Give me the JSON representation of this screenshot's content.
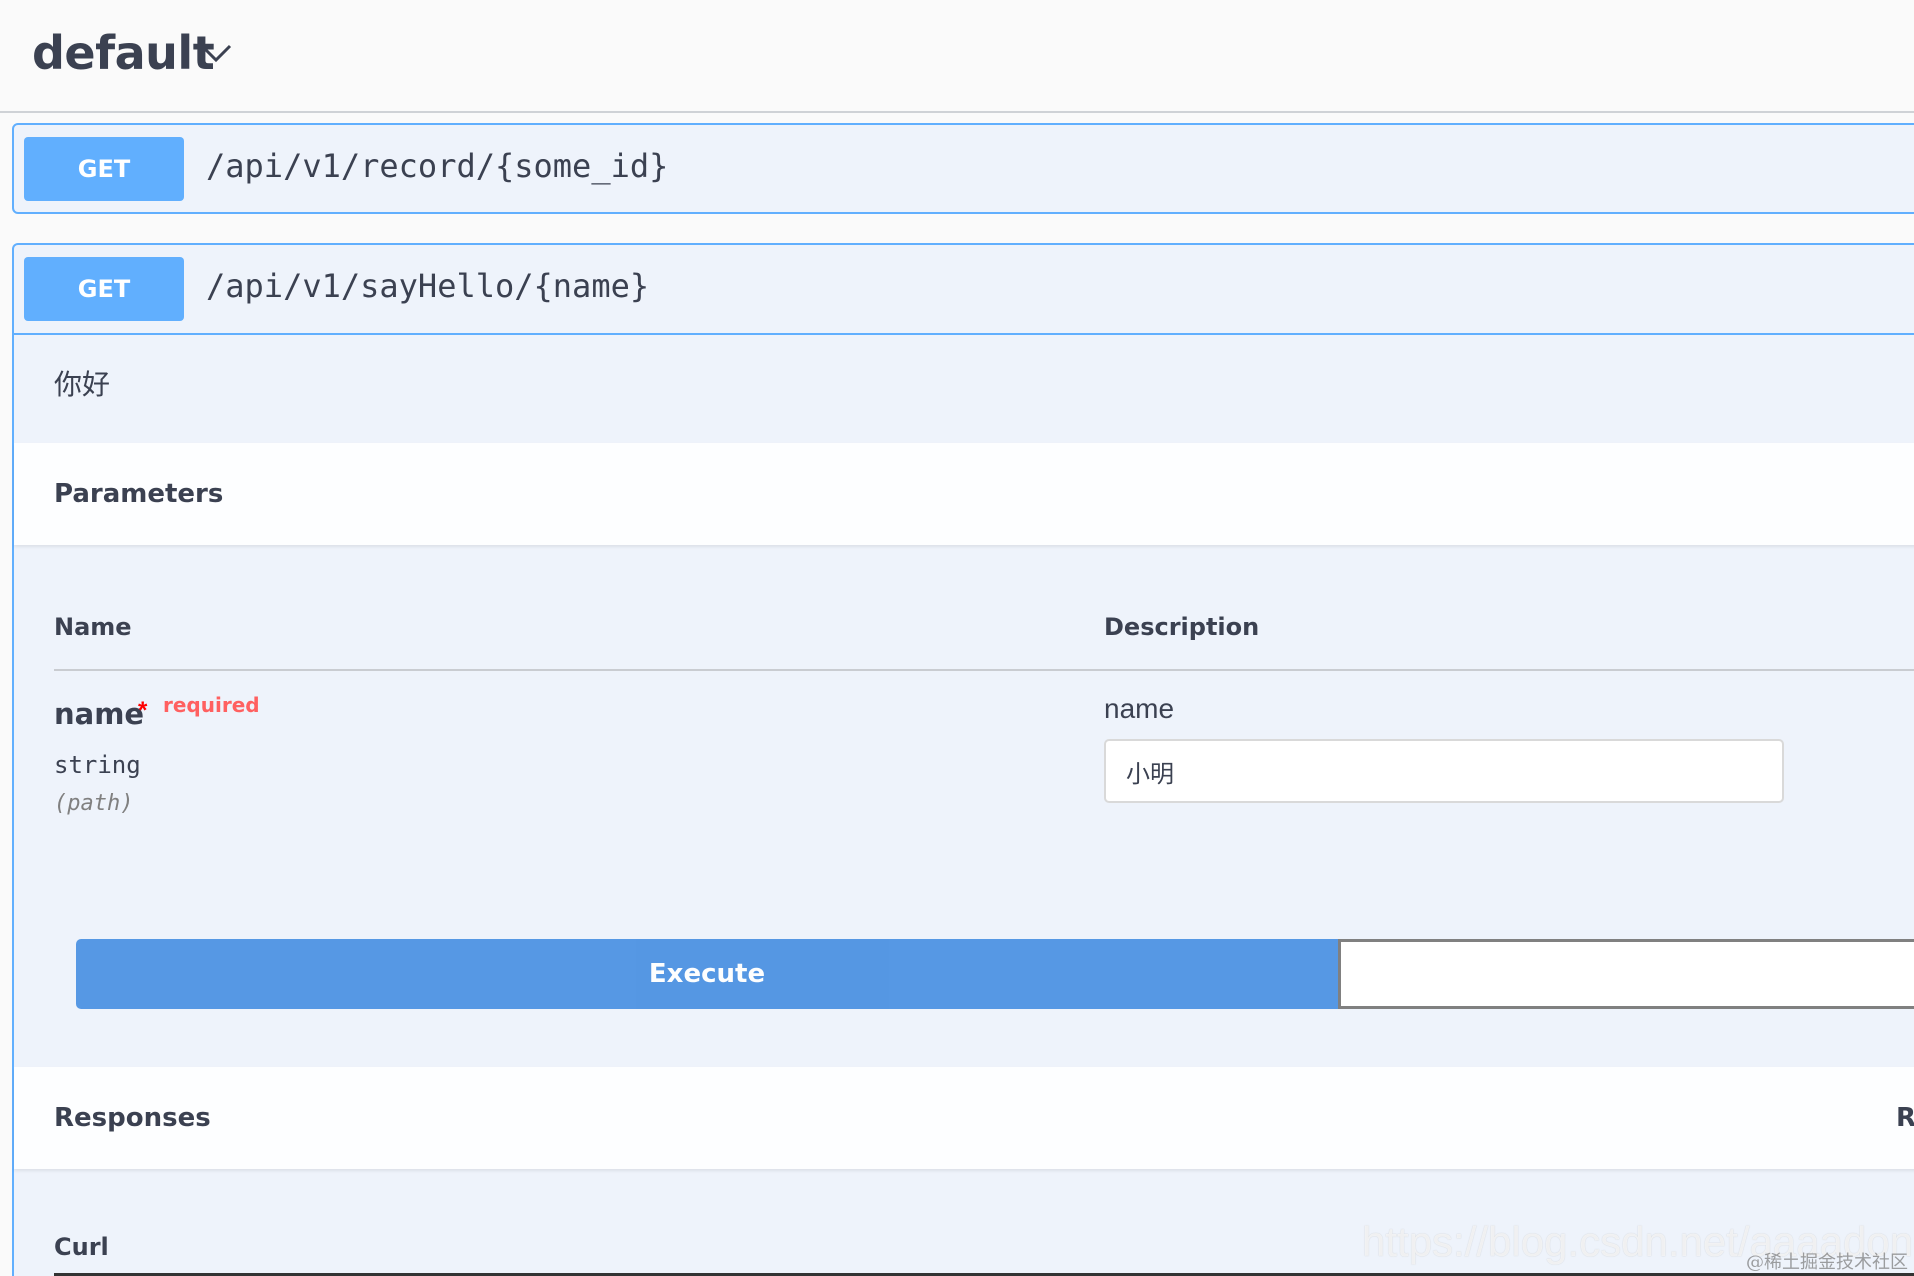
{
  "tag": {
    "title": "default",
    "chevron_icon": "chevron-down-icon"
  },
  "operations": [
    {
      "method": "GET",
      "path": "/api/v1/record/{some_id}"
    },
    {
      "method": "GET",
      "path": "/api/v1/sayHello/{name}"
    }
  ],
  "expanded": {
    "description": "你好",
    "parameters_title": "Parameters",
    "columns": {
      "name": "Name",
      "description": "Description"
    },
    "param": {
      "name": "name",
      "required_star": "*",
      "required_label": "required",
      "type": "string",
      "location": "(path)",
      "field_label": "name",
      "field_value": "小明"
    },
    "execute_label": "Execute",
    "responses_title": "Responses",
    "responses_right_partial": "Re",
    "curl_label": "Curl"
  },
  "watermark": {
    "url": "https://blog.csdn.net/aaaadong",
    "credit": "@稀土掘金技术社区"
  },
  "colors": {
    "get_accent": "#61affe",
    "execute": "#4990e2",
    "required": "#ff6060"
  }
}
